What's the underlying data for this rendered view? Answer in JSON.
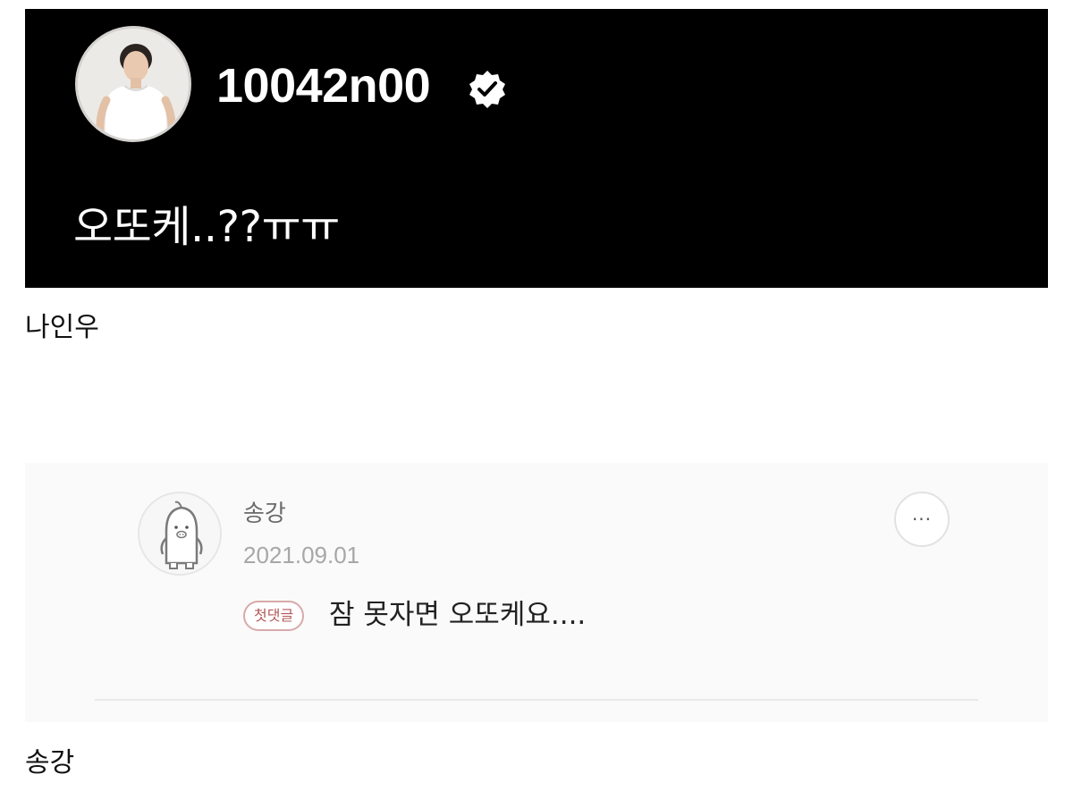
{
  "post": {
    "username": "10042n00",
    "verified_icon": "verified-badge-icon",
    "caption": "오또케..??ㅠㅠ",
    "background": "#000000"
  },
  "label_1": "나인우",
  "comment": {
    "author": "송강",
    "date": "2021.09.01",
    "badge": "첫댓글",
    "text": "잠 못자면 오또케요....",
    "more_icon": "more-options-icon",
    "more_label": "···"
  },
  "label_2": "송강"
}
